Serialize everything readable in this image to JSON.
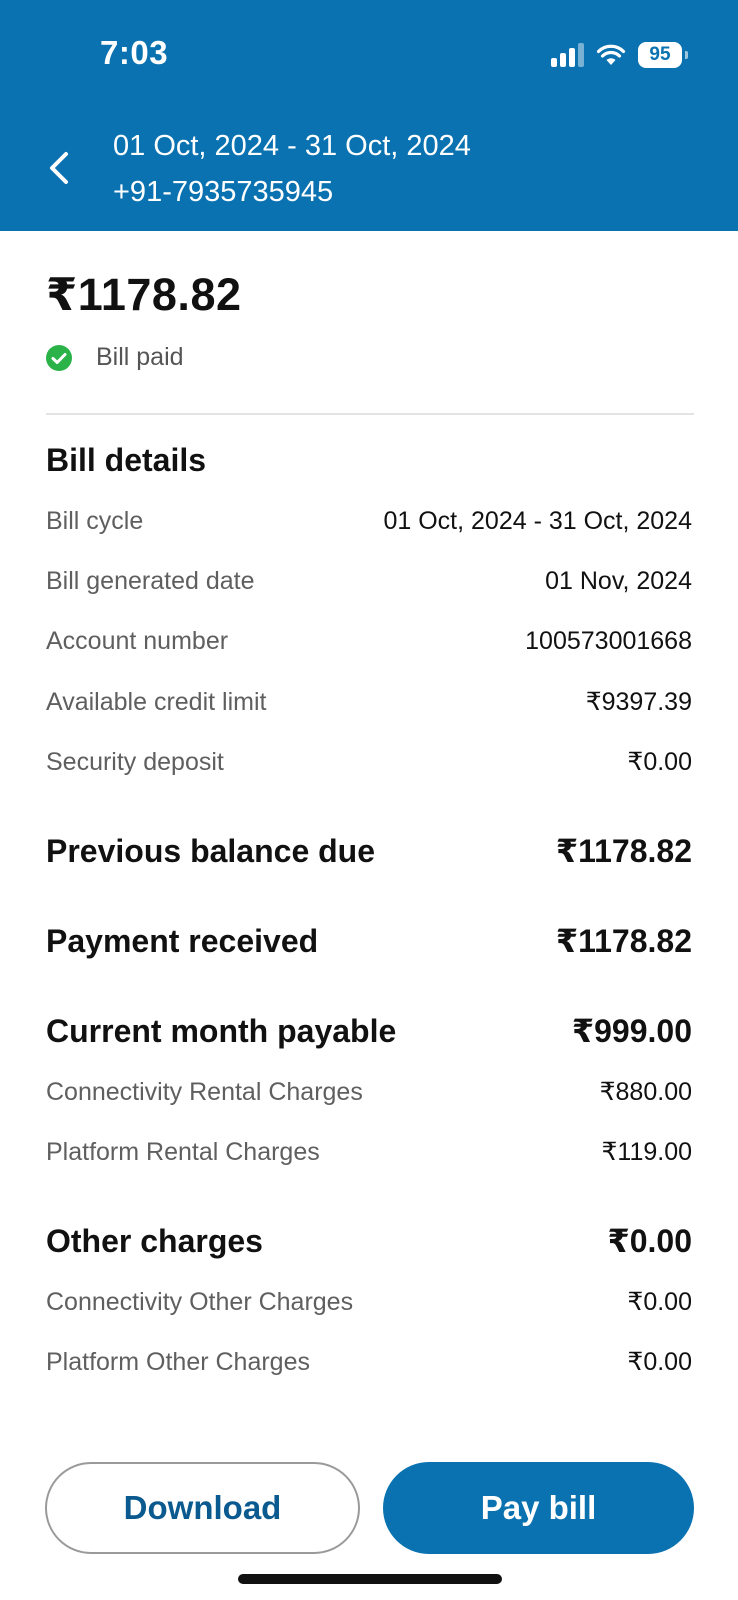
{
  "status_bar": {
    "time": "7:03",
    "battery": "95"
  },
  "header": {
    "period": "01 Oct, 2024 - 31 Oct, 2024",
    "phone": "+91-7935735945"
  },
  "summary": {
    "amount": "₹1178.82",
    "status": "Bill paid"
  },
  "bill_details": {
    "title": "Bill details",
    "rows": [
      {
        "label": "Bill cycle",
        "value": "01 Oct, 2024 - 31 Oct, 2024"
      },
      {
        "label": "Bill generated date",
        "value": "01 Nov, 2024"
      },
      {
        "label": "Account number",
        "value": "100573001668"
      },
      {
        "label": "Available credit limit",
        "value": "₹9397.39"
      },
      {
        "label": "Security deposit",
        "value": "₹0.00"
      }
    ]
  },
  "previous_balance": {
    "label": "Previous balance due",
    "value": "₹1178.82"
  },
  "payment_received": {
    "label": "Payment received",
    "value": "₹1178.82"
  },
  "current_month": {
    "label": "Current month payable",
    "value": "₹999.00",
    "items": [
      {
        "label": "Connectivity Rental Charges",
        "value": "₹880.00"
      },
      {
        "label": "Platform Rental Charges",
        "value": "₹119.00"
      }
    ]
  },
  "other_charges": {
    "label": "Other charges",
    "value": "₹0.00",
    "items": [
      {
        "label": "Connectivity Other Charges",
        "value": "₹0.00"
      },
      {
        "label": "Platform Other Charges",
        "value": "₹0.00"
      }
    ]
  },
  "actions": {
    "download": "Download",
    "pay": "Pay bill"
  },
  "colors": {
    "brand": "#0a72b0",
    "success": "#2bb34a"
  },
  "icons": {
    "back": "chevron-left-icon",
    "signal": "signal-icon",
    "wifi": "wifi-icon",
    "battery": "battery-icon",
    "paid": "check-circle-icon"
  }
}
